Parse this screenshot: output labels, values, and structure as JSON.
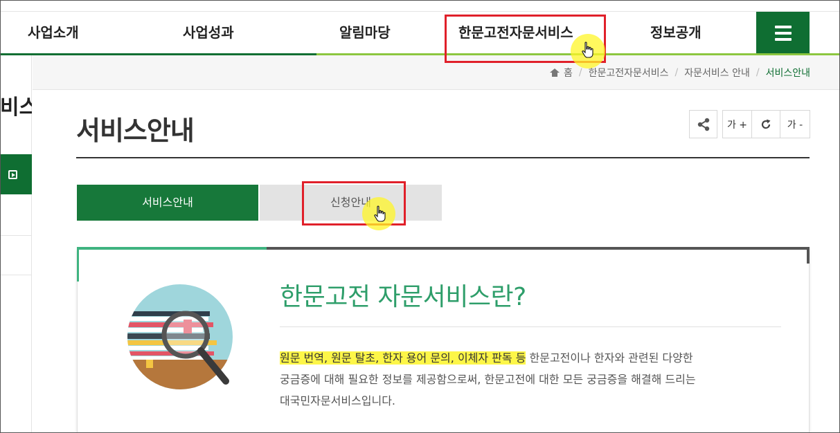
{
  "nav": {
    "items": [
      {
        "label": "사업소개"
      },
      {
        "label": "사업성과"
      },
      {
        "label": "알림마당"
      },
      {
        "label": "한문고전자문서비스"
      },
      {
        "label": "정보공개"
      }
    ],
    "menu_icon": "hamburger-menu-icon"
  },
  "sidebar": {
    "title_fragment": "비스",
    "active_icon": "play-square-icon"
  },
  "breadcrumb": {
    "home_icon": "home-icon",
    "items": [
      "홈",
      "한문고전자문서비스",
      "자문서비스 안내",
      "서비스안내"
    ],
    "separator": "/"
  },
  "page": {
    "title": "서비스안내"
  },
  "tools": {
    "share_icon": "share-icon",
    "font_increase": "가 +",
    "reset_icon": "refresh-icon",
    "font_decrease": "가 -"
  },
  "tabs": [
    {
      "label": "서비스안내",
      "active": true
    },
    {
      "label": "신청안내",
      "active": false
    }
  ],
  "content": {
    "heading": "한문고전 자문서비스란?",
    "highlight": "원문 번역, 원문 탈초, 한자 용어 문의, 이체자 판독 등",
    "body_line1_rest": " 한문고전이나 한자와 관련된 다양한",
    "body_line2": "궁금증에 대해 필요한 정보를 제공함으로써, 한문고전에 대한 모든 궁금증을 해결해 드리는",
    "body_line3": "대국민자문서비스입니다.",
    "illustration": "books-magnifier-illustration"
  },
  "colors": {
    "brand_green": "#0f6e32",
    "light_green": "#8cc63f",
    "heading_green": "#2e9e6a",
    "highlight_yellow": "#fdf648",
    "annotation_red": "#e0202a"
  }
}
